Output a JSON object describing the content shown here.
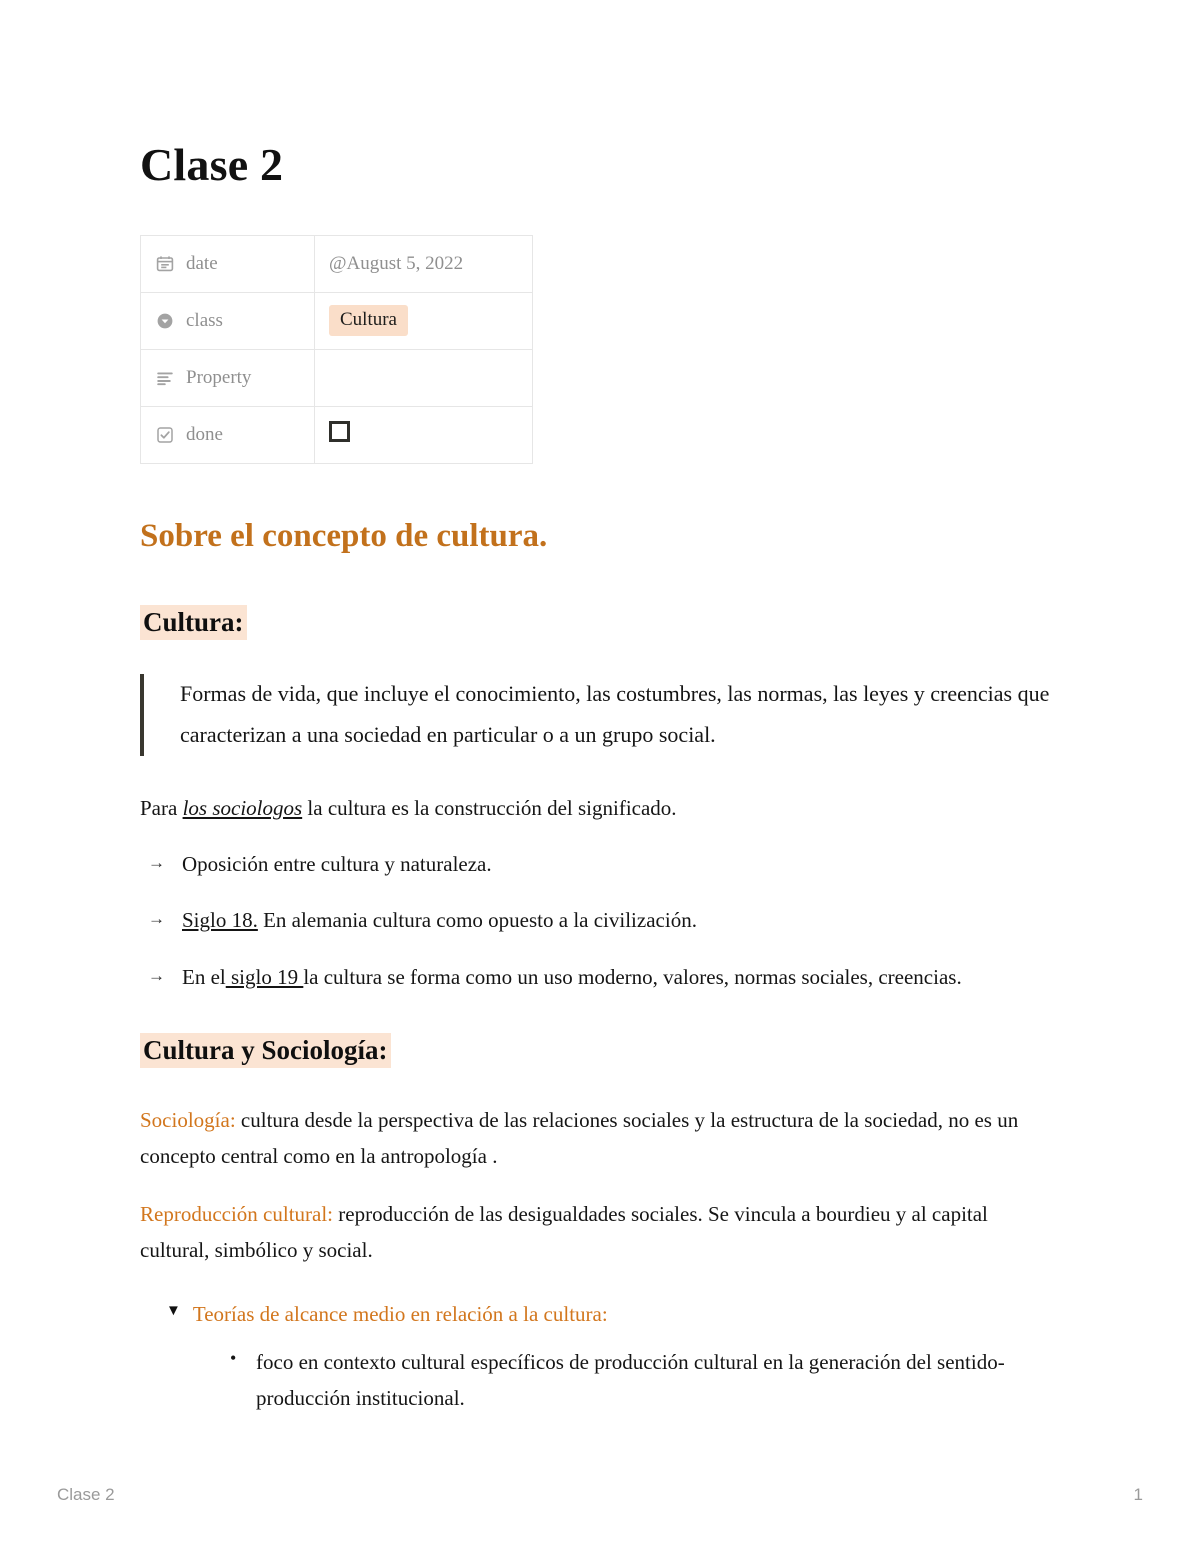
{
  "document": {
    "title": "Clase 2"
  },
  "properties": {
    "rows": [
      {
        "icon": "calendar-icon",
        "key": "date",
        "value": "@August 5, 2022",
        "value_type": "text"
      },
      {
        "icon": "select-chevron-icon",
        "key": "class",
        "value": "Cultura",
        "value_type": "tag"
      },
      {
        "icon": "text-lines-icon",
        "key": "Property",
        "value": "",
        "value_type": "text"
      },
      {
        "icon": "checkbox-icon",
        "key": "done",
        "value": "",
        "value_type": "checkbox",
        "checked": false
      }
    ]
  },
  "content": {
    "section_heading": "Sobre el concepto de cultura.",
    "subheading_cultura": "Cultura:",
    "quote": "Formas de vida, que incluye el conocimiento, las costumbres, las normas, las leyes y creencias que caracterizan a una sociedad en particular o a un grupo social.",
    "para_sociologos": {
      "pre": "Para ",
      "emphasis": "los sociologos",
      "post": " la cultura es la construcción del significado."
    },
    "arrow_items": [
      {
        "marker": "→",
        "pre": "",
        "underline": "",
        "text": "Oposición entre cultura y naturaleza."
      },
      {
        "marker": "→",
        "pre": "",
        "underline": "Siglo 18.",
        "text": " En alemania cultura como opuesto a la civilización."
      },
      {
        "marker": "→",
        "pre": "En el",
        "underline": " siglo 19 ",
        "text": "la cultura se forma como un uso moderno, valores, normas sociales, creencias."
      }
    ],
    "subheading_sociologia": "Cultura y Sociología:",
    "para_sociologia": {
      "label": "Sociología:",
      "text": " cultura desde la perspectiva de las relaciones sociales y la estructura de la sociedad, no es un concepto central como en la antropología ."
    },
    "para_reproduccion": {
      "label": "Reproducción cultural:",
      "text": " reproducción de las desigualdades sociales. Se vincula a bourdieu y al capital cultural, simbólico y social."
    },
    "toggle": {
      "marker": "▼",
      "label": "Teorías de alcance medio en relación a la cultura:",
      "bullets": [
        {
          "marker": "•",
          "text": "foco en contexto cultural específicos de producción cultural en la generación del sentido-producción institucional."
        }
      ]
    }
  },
  "footer": {
    "left": "Clase 2",
    "right": "1"
  },
  "colors": {
    "accent_orange": "#c2711c",
    "inline_orange": "#d2761d",
    "highlight_peach": "#fbe4d3",
    "tag_peach": "#fadec9",
    "table_border": "#e6e6e6",
    "muted_gray": "#8f8f8f",
    "footer_gray": "#9a9a9a"
  }
}
